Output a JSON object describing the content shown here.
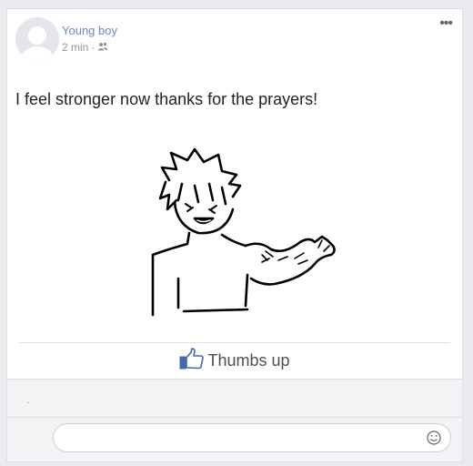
{
  "post": {
    "author": "Young boy",
    "time": "2 min",
    "separator": "·",
    "audience_icon": "friends-icon",
    "menu_icon": "more-options-icon",
    "text": "I feel stronger now thanks for the prayers!"
  },
  "actions": {
    "like_icon": "thumbs-up-icon",
    "like_label": "Thumbs up"
  },
  "comment": {
    "placeholder": "",
    "emoji_icon": "smiley-icon"
  },
  "colors": {
    "author": "#6b88c8",
    "meta": "#90949c",
    "like_icon": "#4267b2",
    "background": "#e9ebee"
  }
}
